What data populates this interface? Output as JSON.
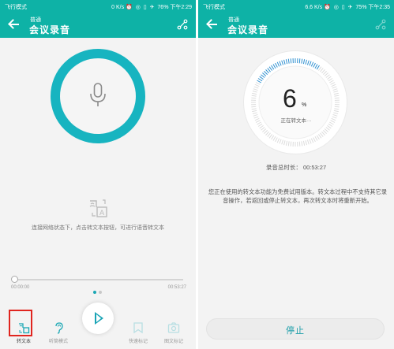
{
  "left": {
    "statusbar": {
      "carrier": "飞行模式",
      "speed": "0 K/s",
      "battery": "76%",
      "time": "下午2:29"
    },
    "appbar": {
      "subtitle": "普通",
      "title": "会议录音"
    },
    "hint_text": "连接网络状态下，点击转文本按钮，可进行语音转文本",
    "player": {
      "time_start": "00:00:00",
      "time_end": "00:53:27",
      "progress": 0.0
    },
    "toolbar": [
      {
        "id": "transcribe",
        "label": "转文本"
      },
      {
        "id": "earpiece",
        "label": "听筒模式"
      },
      {
        "id": "quickmark",
        "label": "快速标记"
      },
      {
        "id": "imagemark",
        "label": "图文标记"
      }
    ]
  },
  "right": {
    "statusbar": {
      "carrier": "飞行模式",
      "speed": "6.6 K/s",
      "battery": "75%",
      "time": "下午2:35"
    },
    "appbar": {
      "subtitle": "普通",
      "title": "会议录音"
    },
    "progress": {
      "value": "6",
      "unit": "%",
      "fraction": 0.06,
      "status": "正在转文本···"
    },
    "total_duration": "录音总时长：  00:53:27",
    "notice": "您正在使用的转文本功能为免费试用版本。转文本过程中不支持其它录音操作，若返回或停止转文本，再次转文本时将重新开始。",
    "stop_label": "停止"
  },
  "colors": {
    "accent": "#0eb2a6",
    "ring": "#17b4c0",
    "highlight": "#e0251f",
    "progress_arc": "#2d8fd0"
  }
}
